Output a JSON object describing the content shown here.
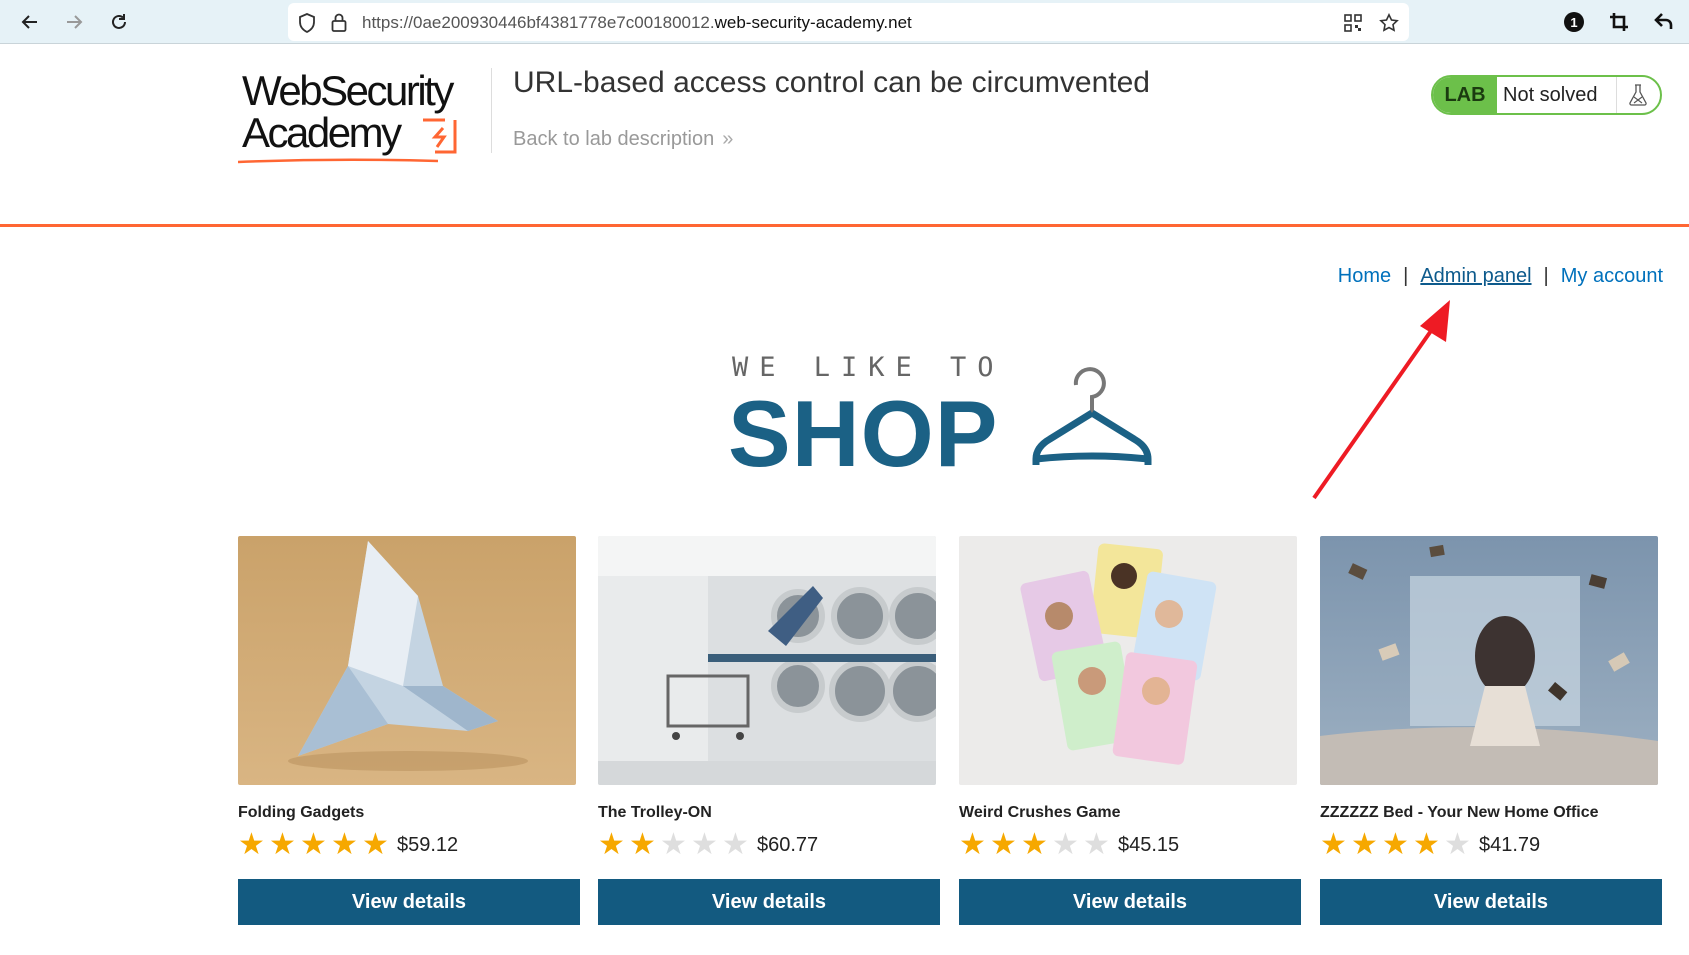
{
  "browser": {
    "url_prefix": "https://0ae200930446bf4381778e7c00180012.",
    "url_domain": "web-security-academy.net"
  },
  "header": {
    "logo_line1": "WebSecurity",
    "logo_line2": "Academy",
    "lab_title": "URL-based access control can be circumvented",
    "back_link": "Back to lab description",
    "lab_tag": "LAB",
    "lab_status": "Not solved"
  },
  "nav": {
    "home": "Home",
    "separator": "|",
    "admin_panel": "Admin panel",
    "my_account": "My account"
  },
  "banner": {
    "tagline": "WE LIKE TO",
    "title": "SHOP"
  },
  "products": [
    {
      "name": "Folding Gadgets",
      "rating": 5,
      "price": "$59.12",
      "button": "View details"
    },
    {
      "name": "The Trolley-ON",
      "rating": 2,
      "price": "$60.77",
      "button": "View details"
    },
    {
      "name": "Weird Crushes Game",
      "rating": 3,
      "price": "$45.15",
      "button": "View details"
    },
    {
      "name": "ZZZZZZ Bed - Your New Home Office",
      "rating": 4,
      "price": "$41.79",
      "button": "View details"
    }
  ],
  "colors": {
    "accent_orange": "#ff6633",
    "brand_blue": "#135a80",
    "lab_green": "#6cc04a",
    "star": "#f6a800"
  }
}
